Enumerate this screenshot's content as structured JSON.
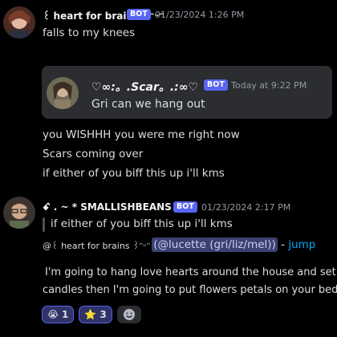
{
  "msg1": {
    "author": "꒰ heart for brains ꒱ᵔᵕᵔ",
    "bot": "BOT",
    "timestamp": "01/23/2024 1:26 PM",
    "text": "falls to my knees"
  },
  "embed": {
    "name": "♡∞:。.Scar。.:∞♡",
    "bot": "BOT",
    "timestamp": "Today at 9:22 PM",
    "text": "Gri can we hang out"
  },
  "msg1_lines": [
    "you WISHHH you were me right now",
    "Scars coming over",
    "if either of you biff this up i'll kms"
  ],
  "msg2": {
    "author": "ꗃ . ~ * SMALLISHBEANS",
    "bot": "BOT",
    "timestamp": "01/23/2024 2:17 PM",
    "reply": "if either of you biff this up i'll kms",
    "at_prefix": "@꒰ heart for brains ꒱ᵔᵕᵔ",
    "mention": "(@lucette (gri/liz/mel))",
    "dash": " - ",
    "jump": "jump",
    "body1": "I'm going to hang love hearts around the house and set up",
    "body2": "candles then I'm going to put flowers petals on your bed"
  },
  "reactions": [
    {
      "emoji": "😭",
      "count": "1"
    },
    {
      "emoji": "⭐",
      "count": "3"
    }
  ],
  "colors": {
    "accent": "#5865f2",
    "link": "#00a8fc",
    "background": "#000000"
  }
}
